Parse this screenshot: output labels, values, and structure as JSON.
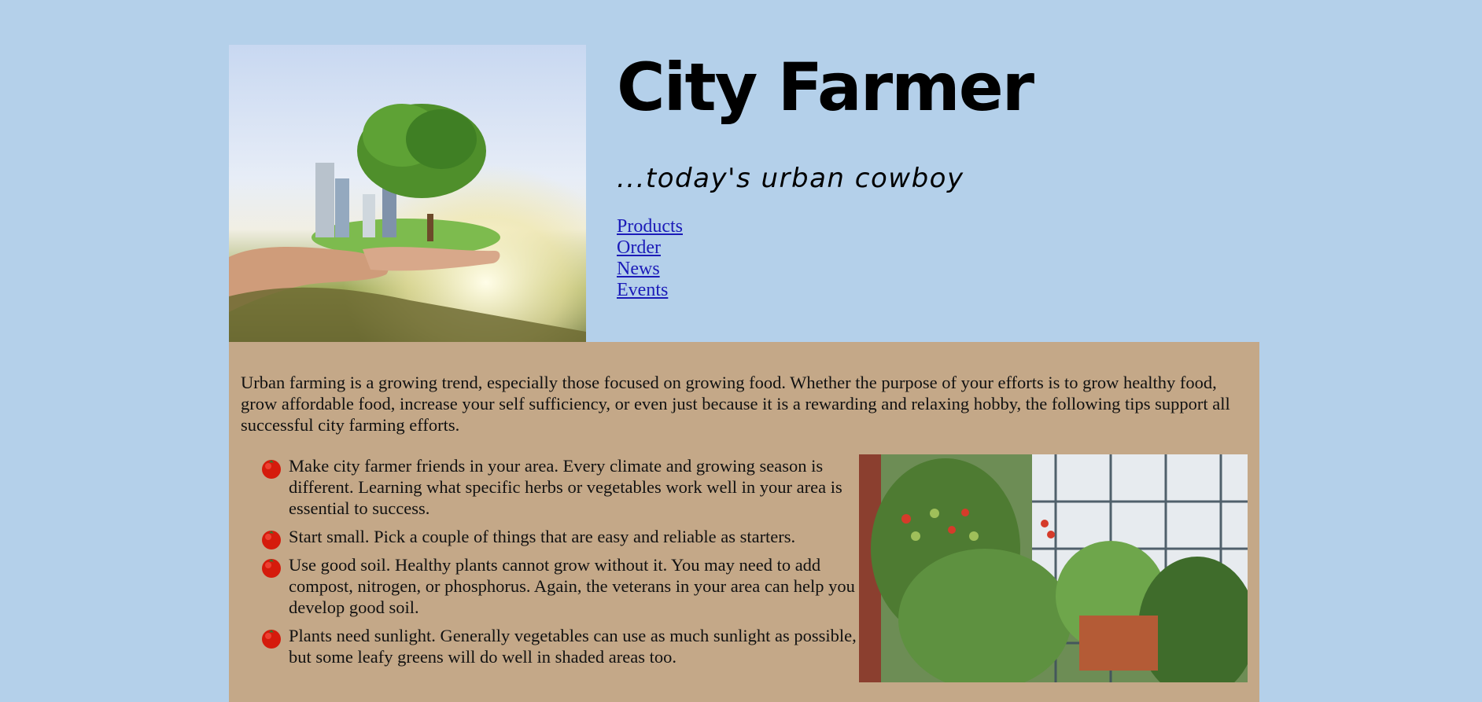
{
  "site": {
    "title": "City Farmer",
    "tagline": "...today's urban cowboy"
  },
  "nav": {
    "items": [
      {
        "label": "Products"
      },
      {
        "label": "Order"
      },
      {
        "label": "News"
      },
      {
        "label": "Events"
      }
    ]
  },
  "main": {
    "intro": "Urban farming is a growing trend, especially those focused on growing food. Whether the purpose of your efforts is to grow healthy food, grow affordable food, increase your self sufficiency, or even just because it is a rewarding and relaxing hobby, the following tips support all successful city farming efforts.",
    "tips": [
      "Make city farmer friends in your area. Every climate and growing season is different. Learning what specific herbs or vegetables work well in your area is essential to success.",
      "Start small. Pick a couple of things that are easy and reliable as starters.",
      "Use good soil. Healthy plants cannot grow without it. You may need to add compost, nitrogen, or phosphorus. Again, the veterans in your area can help you develop good soil.",
      "Plants need sunlight. Generally vegetables can use as much sunlight as possible, but some leafy greens will do well in shaded areas too."
    ]
  },
  "colors": {
    "page_background": "#b4d0ea",
    "content_background": "#c4a888",
    "link": "#1b1bb8"
  },
  "icons": {
    "bullet": "tomato-icon"
  }
}
